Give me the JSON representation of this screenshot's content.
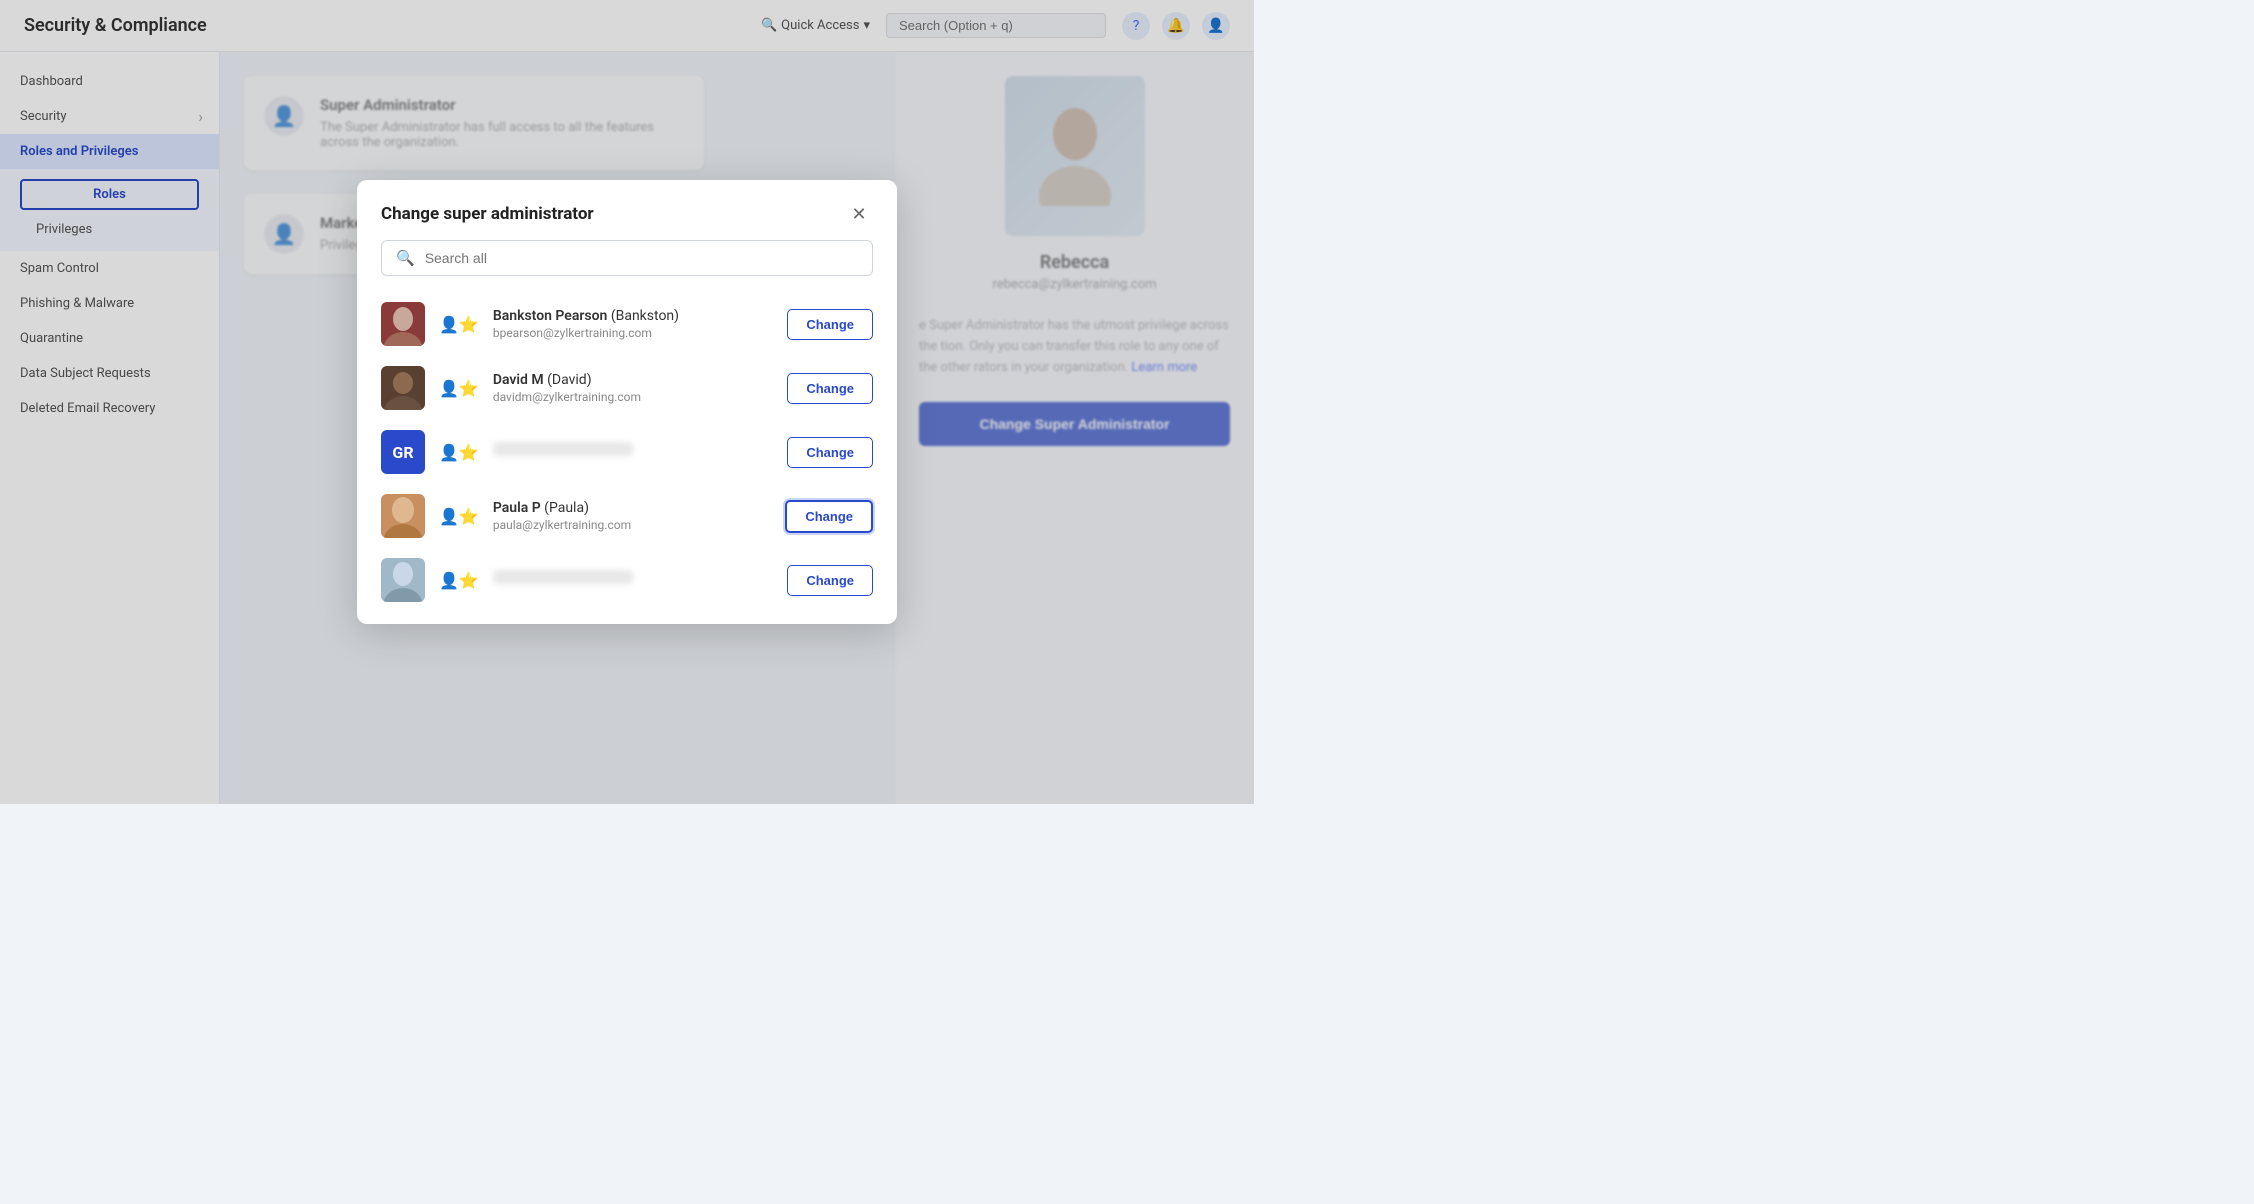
{
  "app": {
    "title": "Security & Compliance"
  },
  "header": {
    "quick_access_label": "Quick Access",
    "search_placeholder": "Search (Option + q)",
    "help_icon": "?",
    "chevron_icon": "▾"
  },
  "sidebar": {
    "dashboard_label": "Dashboard",
    "security_label": "Security",
    "roles_privileges_label": "Roles and Privileges",
    "roles_tab_label": "Roles",
    "privileges_label": "Privileges",
    "spam_control_label": "Spam Control",
    "phishing_malware_label": "Phishing & Malware",
    "quarantine_label": "Quarantine",
    "data_subject_label": "Data Subject Requests",
    "deleted_email_label": "Deleted Email Recovery"
  },
  "background": {
    "super_admin_title": "Super Administrator",
    "super_admin_desc": "The Super Administrator has full access to all the features across the organization.",
    "marketplace_title": "Marketplace Developers",
    "marketplace_desc": "Privileges to build applications for your",
    "person_name": "Rebecca",
    "person_email": "rebecca@zylkertraining.com",
    "desc_text": "e Super Administrator has the utmost privilege across the tion. Only you can transfer this role to any one of the other rators in your organization.",
    "learn_more": "Learn more",
    "change_admin_btn": "Change Super Administrator"
  },
  "modal": {
    "title": "Change super administrator",
    "close_icon": "✕",
    "search_placeholder": "Search all",
    "users": [
      {
        "id": "user1",
        "name": "Bankston Pearson",
        "display_name": "Bankston",
        "email": "bpearson@zylkertraining.com",
        "avatar_type": "photo",
        "avatar_class": "avatar-person-1",
        "blurred": false
      },
      {
        "id": "user2",
        "name": "David M",
        "display_name": "David",
        "email": "davidm@zylkertraining.com",
        "avatar_type": "photo",
        "avatar_class": "avatar-person-2",
        "blurred": false
      },
      {
        "id": "user3",
        "name": "",
        "display_name": "",
        "email": "",
        "avatar_type": "initials",
        "initials": "GR",
        "blurred": true
      },
      {
        "id": "user4",
        "name": "Paula P",
        "display_name": "Paula",
        "email": "paula@zylkertraining.com",
        "avatar_type": "photo",
        "avatar_class": "avatar-person-3",
        "highlighted": true,
        "blurred": false
      },
      {
        "id": "user5",
        "name": "",
        "display_name": "",
        "email": "",
        "avatar_type": "photo",
        "avatar_class": "avatar-person-4",
        "blurred": true
      }
    ],
    "change_btn_label": "Change"
  }
}
